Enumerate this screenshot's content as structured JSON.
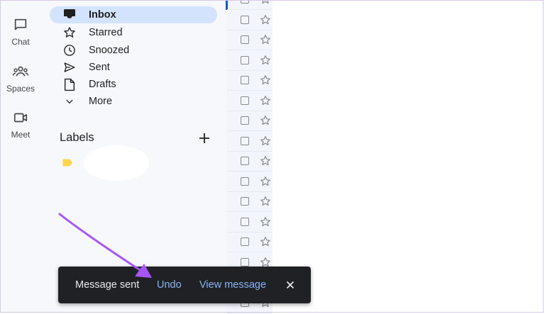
{
  "rail": {
    "items": [
      {
        "label": "Chat",
        "icon": "chat-icon"
      },
      {
        "label": "Spaces",
        "icon": "spaces-icon"
      },
      {
        "label": "Meet",
        "icon": "meet-icon"
      }
    ]
  },
  "nav": {
    "items": [
      {
        "label": "Inbox",
        "icon": "inbox-icon",
        "active": true
      },
      {
        "label": "Starred",
        "icon": "star-icon"
      },
      {
        "label": "Snoozed",
        "icon": "clock-icon"
      },
      {
        "label": "Sent",
        "icon": "send-icon"
      },
      {
        "label": "Drafts",
        "icon": "draft-icon"
      },
      {
        "label": "More",
        "icon": "chevron-down-icon"
      }
    ],
    "labels_title": "Labels"
  },
  "snackbar": {
    "message": "Message sent",
    "undo_label": "Undo",
    "view_label": "View message"
  },
  "colors": {
    "accent": "#0b57d0",
    "active_bg": "#d3e3fd",
    "label_swatch": "#fcd34d",
    "snackbar_bg": "#202124",
    "snackbar_link": "#8ab4f8",
    "annotation_arrow": "#a855f7"
  }
}
